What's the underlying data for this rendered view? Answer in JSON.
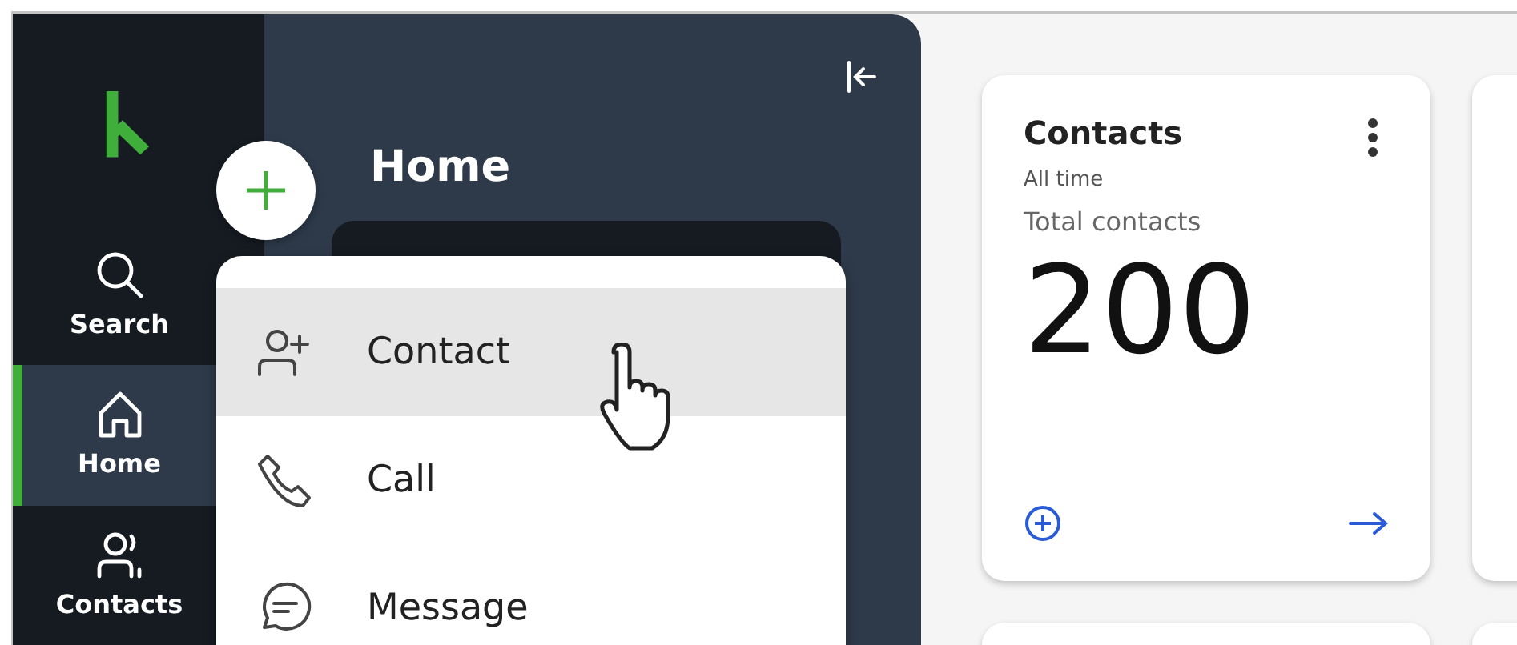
{
  "rail": {
    "items": [
      {
        "label": "Search",
        "kind": "search",
        "selected": false
      },
      {
        "label": "Home",
        "kind": "home",
        "selected": true
      },
      {
        "label": "Contacts",
        "kind": "contacts",
        "selected": false
      }
    ]
  },
  "panel": {
    "title": "Home"
  },
  "quick_add_menu": {
    "items": [
      {
        "label": "Contact",
        "kind": "person-add",
        "highlighted": true
      },
      {
        "label": "Call",
        "kind": "phone",
        "highlighted": false
      },
      {
        "label": "Message",
        "kind": "message",
        "highlighted": false
      }
    ]
  },
  "cards": [
    {
      "title": "Contacts",
      "period": "All time",
      "metric_label": "Total contacts",
      "value": "200"
    }
  ]
}
